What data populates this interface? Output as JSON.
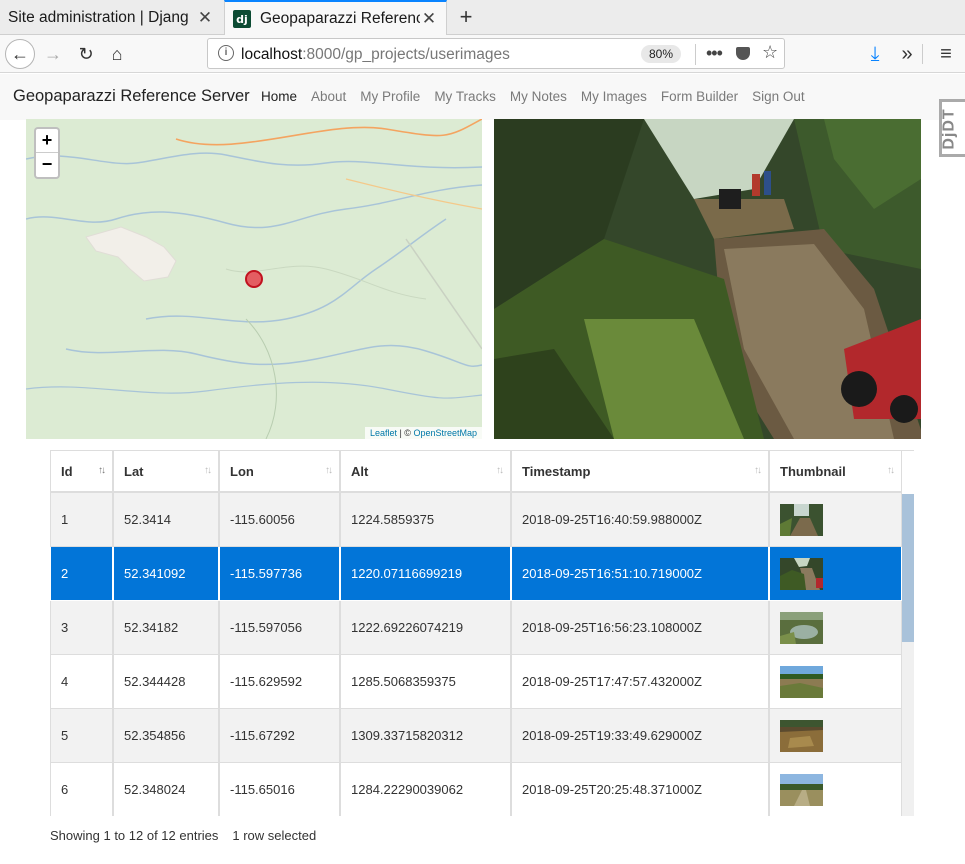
{
  "browser": {
    "tabs": [
      {
        "title": "Site administration | Djang",
        "active": false
      },
      {
        "title": "Geopaparazzi Reference",
        "active": true
      }
    ],
    "url_host": "localhost",
    "url_path": ":8000/gp_projects/userimages",
    "zoom": "80%"
  },
  "site": {
    "brand": "Geopaparazzi Reference Server",
    "nav": [
      "Home",
      "About",
      "My Profile",
      "My Tracks",
      "My Notes",
      "My Images",
      "Form Builder",
      "Sign Out"
    ],
    "active_nav": "Home",
    "debug_toolbar": "DjDT"
  },
  "map": {
    "zoom_in": "+",
    "zoom_out": "−",
    "attribution_leaflet": "Leaflet",
    "attribution_sep": " | © ",
    "attribution_osm": "OpenStreetMap",
    "marker_color": "#e63946"
  },
  "table": {
    "columns": [
      "Id",
      "Lat",
      "Lon",
      "Alt",
      "Timestamp",
      "Thumbnail"
    ],
    "sorted_column": "Id",
    "rows": [
      {
        "id": "1",
        "lat": "52.3414",
        "lon": "-115.60056",
        "alt": "1224.5859375",
        "timestamp": "2018-09-25T16:40:59.988000Z",
        "thumb": "forest-trail"
      },
      {
        "id": "2",
        "lat": "52.341092",
        "lon": "-115.597736",
        "alt": "1220.07116699219",
        "timestamp": "2018-09-25T16:51:10.719000Z",
        "thumb": "creek-atv"
      },
      {
        "id": "3",
        "lat": "52.34182",
        "lon": "-115.597056",
        "alt": "1222.69226074219",
        "timestamp": "2018-09-25T16:56:23.108000Z",
        "thumb": "pond"
      },
      {
        "id": "4",
        "lat": "52.344428",
        "lon": "-115.629592",
        "alt": "1285.5068359375",
        "timestamp": "2018-09-25T17:47:57.432000Z",
        "thumb": "clearing"
      },
      {
        "id": "5",
        "lat": "52.354856",
        "lon": "-115.67292",
        "alt": "1309.33715820312",
        "timestamp": "2018-09-25T19:33:49.629000Z",
        "thumb": "brush"
      },
      {
        "id": "6",
        "lat": "52.348024",
        "lon": "-115.65016",
        "alt": "1284.22290039062",
        "timestamp": "2018-09-25T20:25:48.371000Z",
        "thumb": "meadow"
      }
    ],
    "selected_row": "2"
  },
  "footer": {
    "info": "Showing 1 to 12 of 12 entries",
    "selection": "1 row selected"
  },
  "colors": {
    "selection": "#0275d8",
    "map_bg": "#dcebd3"
  }
}
